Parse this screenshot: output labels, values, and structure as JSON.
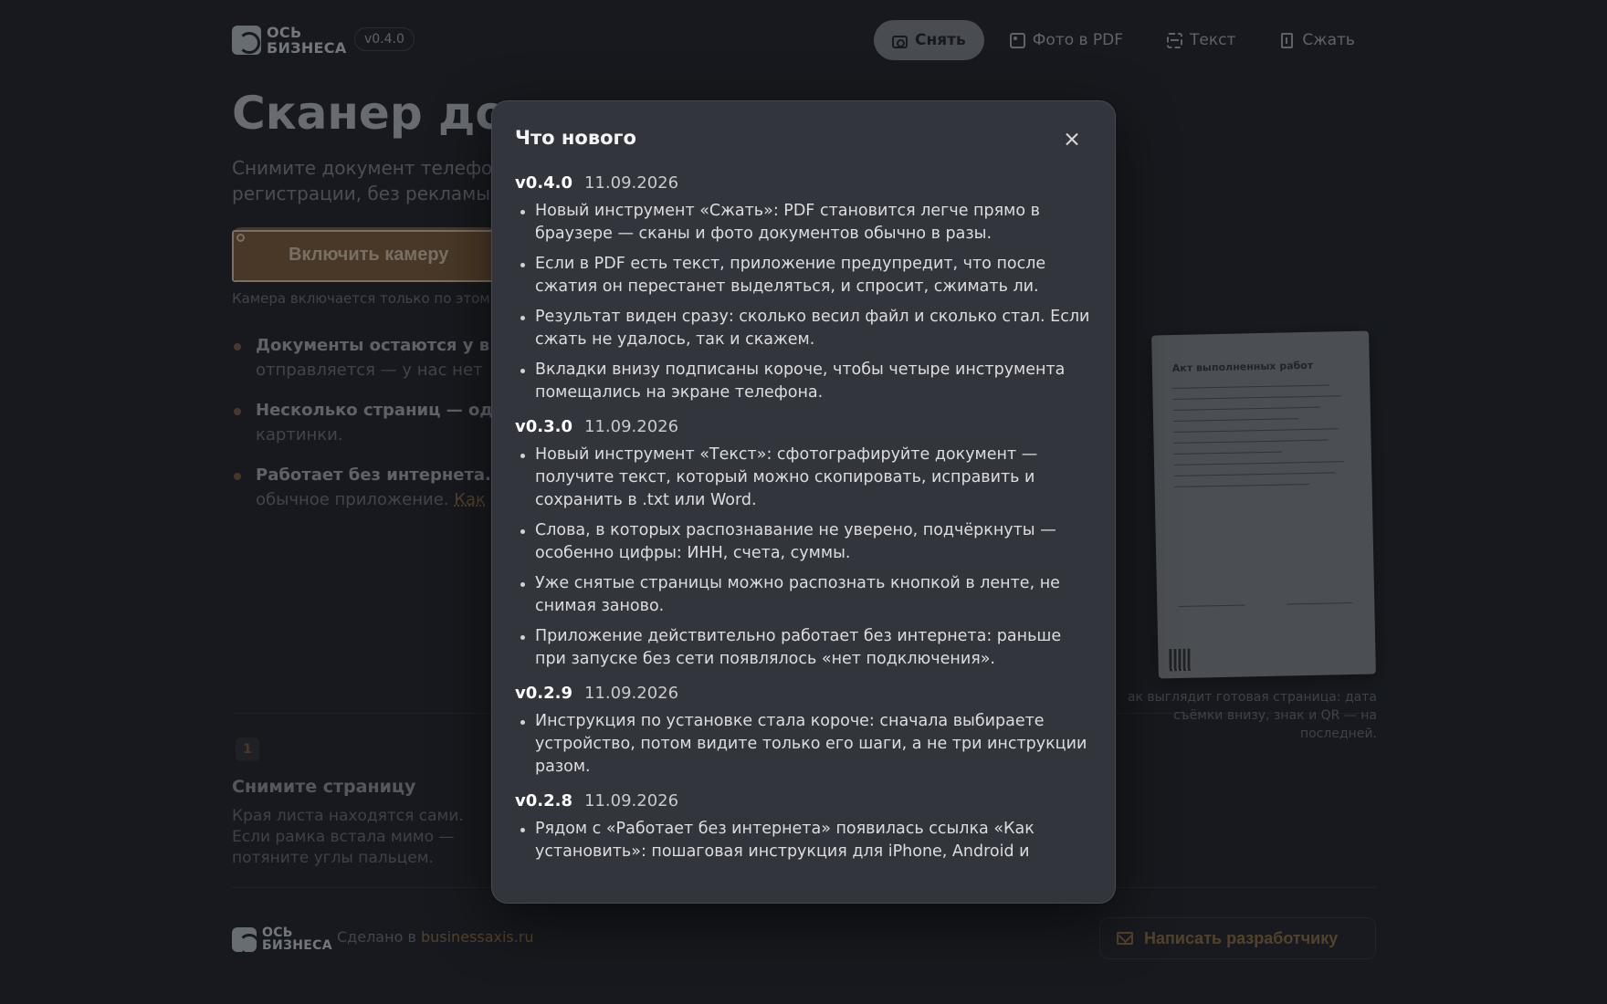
{
  "header": {
    "logo_line1": "ОСЬ",
    "logo_line2": "БИЗНЕСА",
    "version": "v0.4.0",
    "tabs": [
      {
        "label": "Снять",
        "icon": "camera-icon",
        "active": true
      },
      {
        "label": "Фото в PDF",
        "icon": "image-icon",
        "active": false
      },
      {
        "label": "Текст",
        "icon": "text-scan-icon",
        "active": false
      },
      {
        "label": "Сжать",
        "icon": "file-compress-icon",
        "active": false
      }
    ]
  },
  "hero": {
    "title": "Сканер до",
    "subtitle_line1": "Снимите документ телефо",
    "subtitle_line2": "регистрации, без рекламы,",
    "cta_label": "Включить камеру",
    "cta_note": "Камера включается только по этом"
  },
  "features": [
    {
      "title": "Документы остаются у в",
      "text": "отправляется — у нас нет",
      "link": ""
    },
    {
      "title": "Несколько страниц — од",
      "text": "картинки.",
      "link": ""
    },
    {
      "title": "Работает без интернета.",
      "text": "обычное приложение. ",
      "link": "Как"
    }
  ],
  "step": {
    "number": "1",
    "title": "Снимите страницу",
    "text": "Края листа находятся сами. Если рамка встала мимо — потяните углы пальцем."
  },
  "preview": {
    "doc_title": "Акт выполненных работ",
    "caption": "ак выглядит готовая страница: дата съёмки внизу, знак и QR — на последней."
  },
  "footer": {
    "made_by": "Сделано в ",
    "made_link": "businessaxis.ru",
    "contact_label": "Написать разработчику"
  },
  "modal": {
    "title": "Что нового",
    "releases": [
      {
        "version": "v0.4.0",
        "date": "11.09.2026",
        "items": [
          "Новый инструмент «Сжать»: PDF становится легче прямо в браузере — сканы и фото документов обычно в разы.",
          "Если в PDF есть текст, приложение предупредит, что после сжатия он перестанет выделяться, и спросит, сжимать ли.",
          "Результат виден сразу: сколько весил файл и сколько стал. Если сжать не удалось, так и скажем.",
          "Вкладки внизу подписаны короче, чтобы четыре инструмента помещались на экране телефона."
        ]
      },
      {
        "version": "v0.3.0",
        "date": "11.09.2026",
        "items": [
          "Новый инструмент «Текст»: сфотографируйте документ — получите текст, который можно скопировать, исправить и сохранить в .txt или Word.",
          "Слова, в которых распознавание не уверено, подчёркнуты — особенно цифры: ИНН, счета, суммы.",
          "Уже снятые страницы можно распознать кнопкой в ленте, не снимая заново.",
          "Приложение действительно работает без интернета: раньше при запуске без сети появлялось «нет подключения»."
        ]
      },
      {
        "version": "v0.2.9",
        "date": "11.09.2026",
        "items": [
          "Инструкция по установке стала короче: сначала выбираете устройство, потом видите только его шаги, а не три инструкции разом."
        ]
      },
      {
        "version": "v0.2.8",
        "date": "11.09.2026",
        "items": [
          "Рядом с «Работает без интернета» появилась ссылка «Как установить»: пошаговая инструкция для iPhone, Android и"
        ]
      }
    ]
  }
}
